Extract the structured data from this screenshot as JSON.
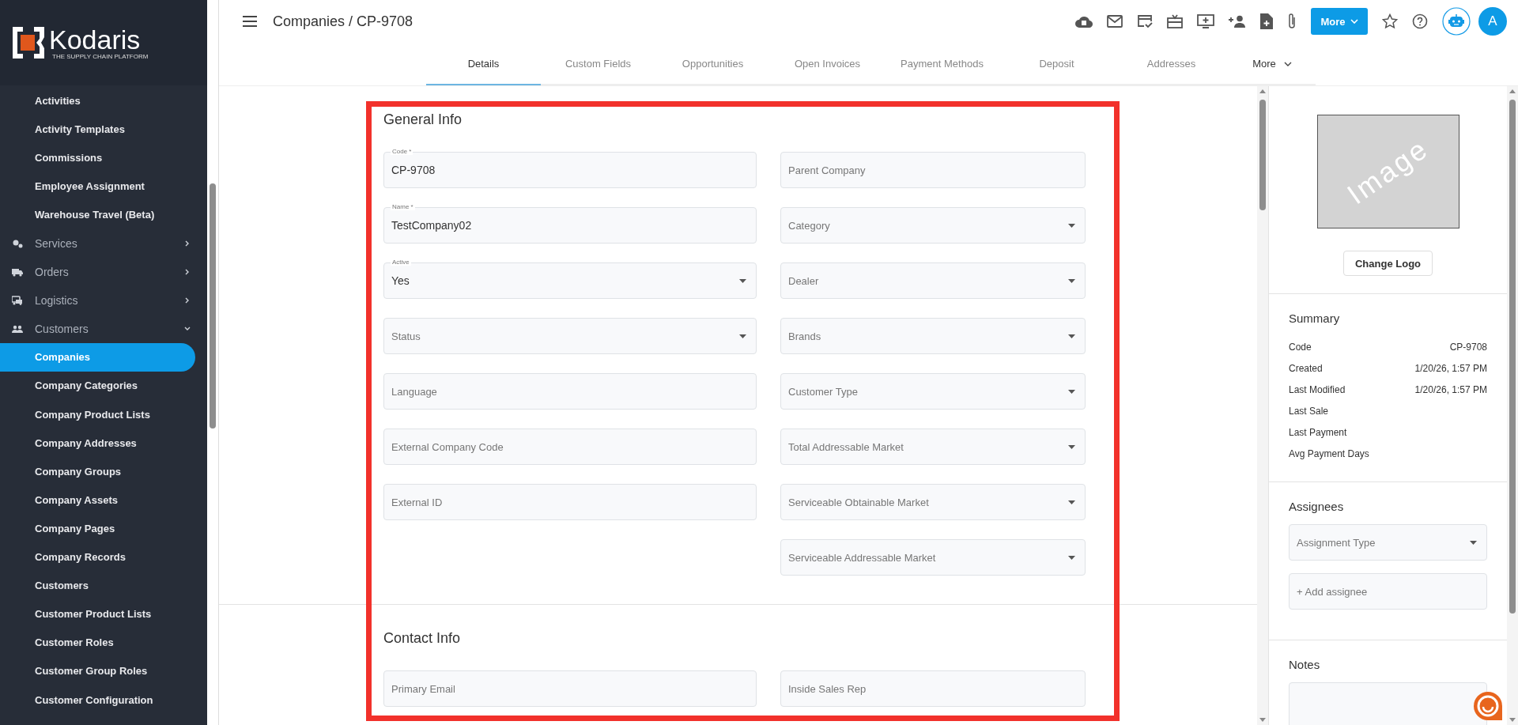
{
  "brand": {
    "name": "Kodaris",
    "tagline": "THE SUPPLY CHAIN PLATFORM"
  },
  "sidebar": {
    "items": [
      {
        "kind": "link",
        "label": "Activities",
        "selected": false
      },
      {
        "kind": "link",
        "label": "Activity Templates",
        "selected": false
      },
      {
        "kind": "link",
        "label": "Commissions",
        "selected": false
      },
      {
        "kind": "link",
        "label": "Employee Assignment",
        "selected": false
      },
      {
        "kind": "link",
        "label": "Warehouse Travel (Beta)",
        "selected": false
      },
      {
        "kind": "group",
        "label": "Services",
        "expanded": false
      },
      {
        "kind": "group",
        "label": "Orders",
        "expanded": false
      },
      {
        "kind": "group",
        "label": "Logistics",
        "expanded": false
      },
      {
        "kind": "group",
        "label": "Customers",
        "expanded": true,
        "children": [
          {
            "label": "Companies",
            "selected": true
          },
          {
            "label": "Company Categories",
            "selected": false
          },
          {
            "label": "Company Product Lists",
            "selected": false
          },
          {
            "label": "Company Addresses",
            "selected": false
          },
          {
            "label": "Company Groups",
            "selected": false
          },
          {
            "label": "Company Assets",
            "selected": false
          },
          {
            "label": "Company Pages",
            "selected": false
          },
          {
            "label": "Company Records",
            "selected": false
          },
          {
            "label": "Customers",
            "selected": false
          },
          {
            "label": "Customer Product Lists",
            "selected": false
          },
          {
            "label": "Customer Roles",
            "selected": false
          },
          {
            "label": "Customer Group Roles",
            "selected": false
          },
          {
            "label": "Customer Configuration",
            "selected": false
          }
        ]
      }
    ]
  },
  "header": {
    "title": "Companies / CP-9708",
    "more_button": "More",
    "avatar": "A"
  },
  "tabs": [
    {
      "label": "Details",
      "selected": true
    },
    {
      "label": "Custom Fields",
      "selected": false
    },
    {
      "label": "Opportunities",
      "selected": false
    },
    {
      "label": "Open Invoices",
      "selected": false
    },
    {
      "label": "Payment Methods",
      "selected": false
    },
    {
      "label": "Deposit",
      "selected": false
    },
    {
      "label": "Addresses",
      "selected": false
    },
    {
      "label": "More",
      "selected": false,
      "kind": "menu"
    }
  ],
  "general_info": {
    "title": "General Info",
    "fields": [
      {
        "kind": "text",
        "label": "Code *",
        "value": "CP-9708"
      },
      {
        "kind": "text",
        "placeholder": "Parent Company"
      },
      {
        "kind": "text",
        "label": "Name *",
        "value": "TestCompany02"
      },
      {
        "kind": "select",
        "placeholder": "Category"
      },
      {
        "kind": "select",
        "label": "Active",
        "value": "Yes"
      },
      {
        "kind": "select",
        "placeholder": "Dealer"
      },
      {
        "kind": "select",
        "placeholder": "Status"
      },
      {
        "kind": "select",
        "placeholder": "Brands"
      },
      {
        "kind": "text",
        "placeholder": "Language"
      },
      {
        "kind": "select",
        "placeholder": "Customer Type"
      },
      {
        "kind": "text",
        "placeholder": "External Company Code"
      },
      {
        "kind": "select",
        "placeholder": "Total Addressable Market"
      },
      {
        "kind": "text",
        "placeholder": "External ID"
      },
      {
        "kind": "select",
        "placeholder": "Serviceable Obtainable Market"
      },
      {
        "kind": "empty"
      },
      {
        "kind": "select",
        "placeholder": "Serviceable Addressable Market"
      }
    ]
  },
  "contact_info": {
    "title": "Contact Info",
    "fields": [
      {
        "placeholder": "Primary Email"
      },
      {
        "placeholder": "Inside Sales Rep"
      }
    ]
  },
  "side_panel": {
    "logo_placeholder": "Image",
    "change_logo": "Change Logo",
    "summary": {
      "title": "Summary",
      "rows": [
        {
          "label": "Code",
          "value": "CP-9708"
        },
        {
          "label": "Created",
          "value": "1/20/26, 1:57 PM"
        },
        {
          "label": "Last Modified",
          "value": "1/20/26, 1:57 PM"
        },
        {
          "label": "Last Sale"
        },
        {
          "label": "Last Payment"
        },
        {
          "label": "Avg Payment Days"
        }
      ]
    },
    "assignees": {
      "title": "Assignees",
      "type_placeholder": "Assignment Type",
      "add_placeholder": "+ Add assignee"
    },
    "notes": {
      "title": "Notes"
    }
  }
}
